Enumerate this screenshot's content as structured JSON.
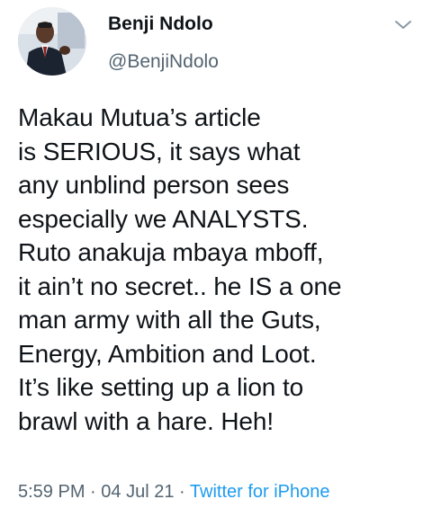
{
  "author": {
    "display_name": "Benji Ndolo",
    "handle": "@BenjiNdolo",
    "avatar_icon": "profile-photo"
  },
  "menu": {
    "icon": "chevron-down-icon"
  },
  "tweet": {
    "lines": [
      "Makau Mutua’s article",
      "is SERIOUS, it says what",
      "any unblind person sees",
      "especially we ANALYSTS.",
      "Ruto anakuja mbaya mboff,",
      "it ain’t no secret.. he IS a one",
      "man army with all the Guts,",
      "Energy, Ambition and Loot.",
      "It’s like setting up a lion to",
      "brawl with a hare. Heh!"
    ]
  },
  "meta": {
    "time": "5:59 PM",
    "separator": "·",
    "date": "04 Jul 21",
    "source": "Twitter for iPhone"
  },
  "colors": {
    "text": "#0f1419",
    "secondary": "#536471",
    "link": "#1d9bf0"
  }
}
